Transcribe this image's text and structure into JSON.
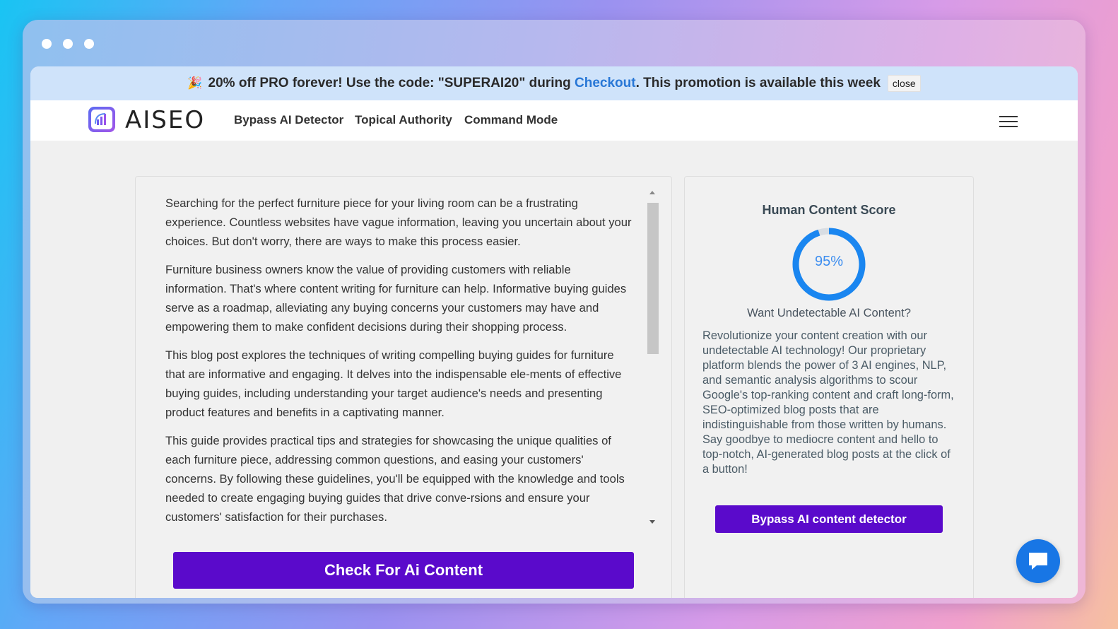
{
  "promo": {
    "icon": "party-popper-icon",
    "emoji": "🎉",
    "text_before": "20% off PRO forever! Use the code: \"SUPERAI20\" during ",
    "link": "Checkout",
    "text_after": ". This promotion is available this week",
    "close_label": "close"
  },
  "brand": {
    "name": "AISEO"
  },
  "nav": {
    "links": [
      "Bypass AI Detector",
      "Topical Authority",
      "Command Mode"
    ]
  },
  "editor": {
    "paragraphs": [
      "Searching for the perfect furniture piece for your living room can be a frustrating experience. Countless websites have vague information, leaving you uncertain about your choices. But don't worry, there are ways to make this process easier.",
      "Furniture business owners know the value of providing customers with reliable information. That's where content writing for furniture can help. Informative buying guides serve as a roadmap, alleviating any buying concerns your customers may have and empowering them to make confident decisions during their shopping process.",
      "This blog post explores the techniques of writing compelling buying guides for furniture that are informative and engaging. It delves into the indispensable ele-ments of effective buying guides, including understanding your target audience's needs and presenting product features and benefits in a captivating manner.",
      "This guide provides practical tips and strategies for showcasing the unique qualities of each furniture piece, addressing common questions, and easing your customers' concerns. By following these guidelines, you'll be equipped with the knowledge and tools needed to create engaging buying guides that drive conve-rsions and ensure your customers' satisfaction for their purchases."
    ],
    "check_button": "Check For Ai Content"
  },
  "score": {
    "title": "Human Content Score",
    "value": 95,
    "label": "95%",
    "ring_color": "#1a86f0",
    "track_color": "#d8dde3",
    "subtitle": "Want Undetectable AI Content?",
    "description": "Revolutionize your content creation with our undetectable AI technology! Our proprietary platform blends the power of 3 AI engines, NLP, and semantic analysis algorithms to scour Google's top-ranking content and craft long-form, SEO-optimized blog posts that are indistinguishable from those written by humans. Say goodbye to mediocre content and hello to top-notch, AI-generated blog posts at the click of a button!",
    "bypass_button": "Bypass AI content detector"
  },
  "colors": {
    "primary_button": "#5a0acb",
    "link": "#2877d6",
    "chat": "#1876e5"
  },
  "chat": {
    "icon": "chat-icon"
  }
}
